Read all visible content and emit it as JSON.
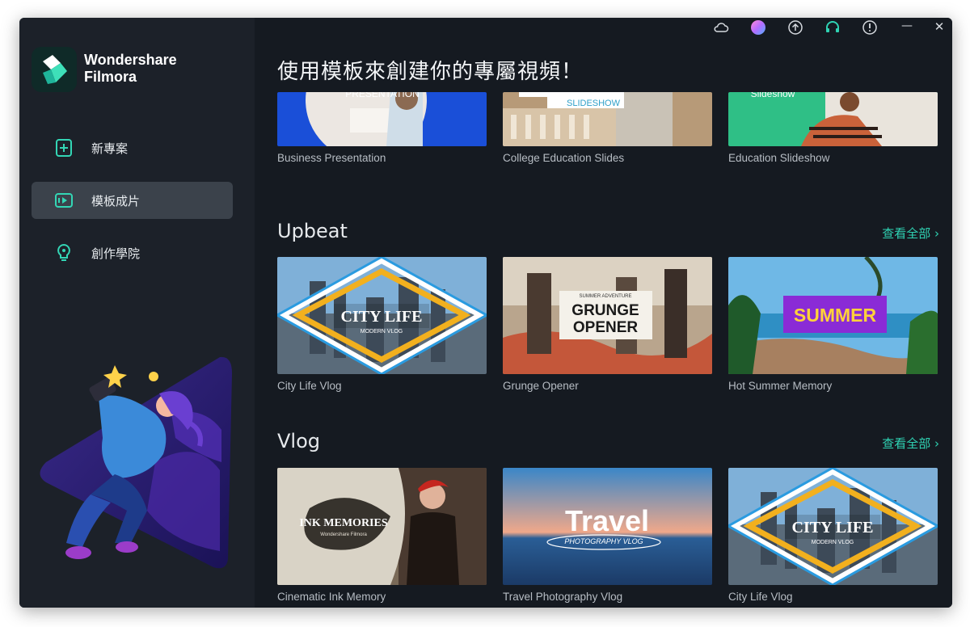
{
  "app": {
    "brand_line1": "Wondershare",
    "brand_line2": "Filmora"
  },
  "titlebar": {
    "icons": [
      "cloud-icon",
      "avatar",
      "upload-icon",
      "headset-icon",
      "info-icon",
      "minimize-icon",
      "close-icon"
    ],
    "minimize_glyph": "—",
    "close_glyph": "✕"
  },
  "sidebar": {
    "items": [
      {
        "label": "新專案",
        "icon": "new-project-icon",
        "active": false
      },
      {
        "label": "模板成片",
        "icon": "template-icon",
        "active": true
      },
      {
        "label": "創作學院",
        "icon": "academy-icon",
        "active": false
      }
    ]
  },
  "main": {
    "heading": "使用模板來創建你的專屬視頻！",
    "top_row": [
      {
        "label": "Business Presentation",
        "thumb_text": "PRESENTATION"
      },
      {
        "label": "College Education Slides",
        "thumb_text": "SLIDESHOW"
      },
      {
        "label": "Education Slideshow",
        "thumb_text": "Slideshow"
      }
    ],
    "sections": [
      {
        "title": "Upbeat",
        "see_all": "查看全部 ›",
        "cards": [
          {
            "label": "City Life Vlog",
            "thumb_text": "CITY LIFE",
            "thumb_sub": "MODERN VLOG"
          },
          {
            "label": "Grunge Opener",
            "thumb_text": "GRUNGE",
            "thumb_text2": "OPENER",
            "thumb_sub": "SUMMER ADVENTURE"
          },
          {
            "label": "Hot Summer Memory",
            "thumb_text": "SUMMER"
          }
        ]
      },
      {
        "title": "Vlog",
        "see_all": "查看全部 ›",
        "cards": [
          {
            "label": "Cinematic Ink Memory",
            "thumb_text": "INK MEMORIES",
            "thumb_sub": "Wondershare Filmora"
          },
          {
            "label": "Travel Photography Vlog",
            "thumb_text": "Travel",
            "thumb_sub": "PHOTOGRAPHY VLOG"
          },
          {
            "label": "City Life Vlog",
            "thumb_text": "CITY LIFE",
            "thumb_sub": "MODERN VLOG"
          }
        ]
      }
    ]
  },
  "colors": {
    "accent": "#2fd2b3",
    "sidebar_bg": "#1c2129",
    "main_bg": "#151a21",
    "active_nav": "#3b424b"
  }
}
